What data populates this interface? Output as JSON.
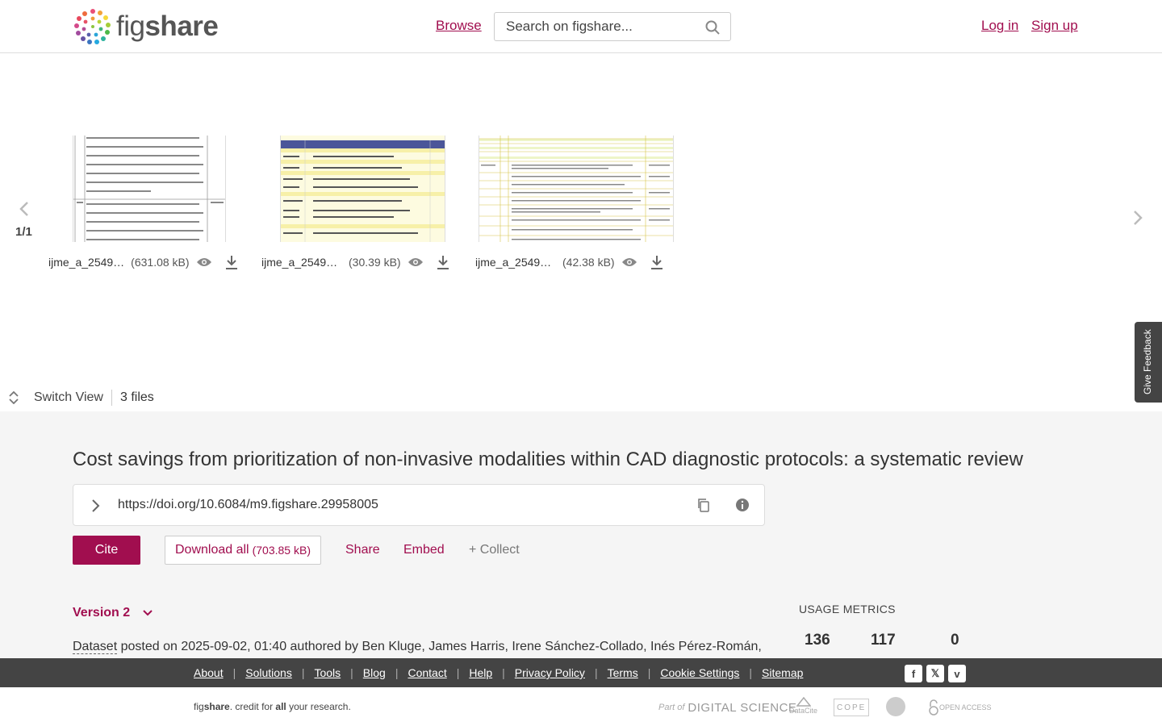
{
  "header": {
    "logo_text_a": "fig",
    "logo_text_b": "share",
    "browse_label": "Browse",
    "search_placeholder": "Search on figshare...",
    "login_label": "Log in",
    "signup_label": "Sign up"
  },
  "viewer": {
    "page_counter": "1/1",
    "files": [
      {
        "name": "ijme_a_2549…",
        "size": "(631.08 kB)"
      },
      {
        "name": "ijme_a_25496…",
        "size": "(30.39 kB)"
      },
      {
        "name": "ijme_a_25496…",
        "size": "(42.38 kB)"
      }
    ],
    "switch_view_label": "Switch View",
    "file_count": "3 files",
    "feedback_label": "Give Feedback"
  },
  "item": {
    "title": "Cost savings from prioritization of non-invasive modalities within CAD diagnostic protocols: a systematic review",
    "doi": "https://doi.org/10.6084/m9.figshare.29958005",
    "cite_label": "Cite",
    "download_label": "Download all",
    "download_size": "(703.85 kB)",
    "share_label": "Share",
    "embed_label": "Embed",
    "collect_label": "+ Collect",
    "version_label": "Version 2",
    "item_type": "Dataset",
    "posted_text": " posted on 2025-09-02, 01:40 authored by Ben Kluge, James Harris, Irene Sánchez-Collado, Inés Pérez-Román,"
  },
  "usage_metrics": {
    "label": "USAGE METRICS",
    "values": [
      "136",
      "117",
      "0"
    ]
  },
  "footer": {
    "links": [
      "About",
      "Solutions",
      "Tools",
      "Blog",
      "Contact",
      "Help",
      "Privacy Policy",
      "Terms",
      "Cookie Settings",
      "Sitemap"
    ],
    "credit_fig": "fig",
    "credit_share": "share",
    "credit_mid": ". credit for ",
    "credit_all": "all",
    "credit_end": " your research.",
    "partners": {
      "part_of": "Part of",
      "digital_science": "DIGITAL SCIENCE",
      "datacite": "DataCite",
      "cope": "COPE",
      "open_access": "OPEN ACCESS"
    },
    "social": [
      "facebook-icon",
      "x-icon",
      "vimeo-icon"
    ]
  }
}
